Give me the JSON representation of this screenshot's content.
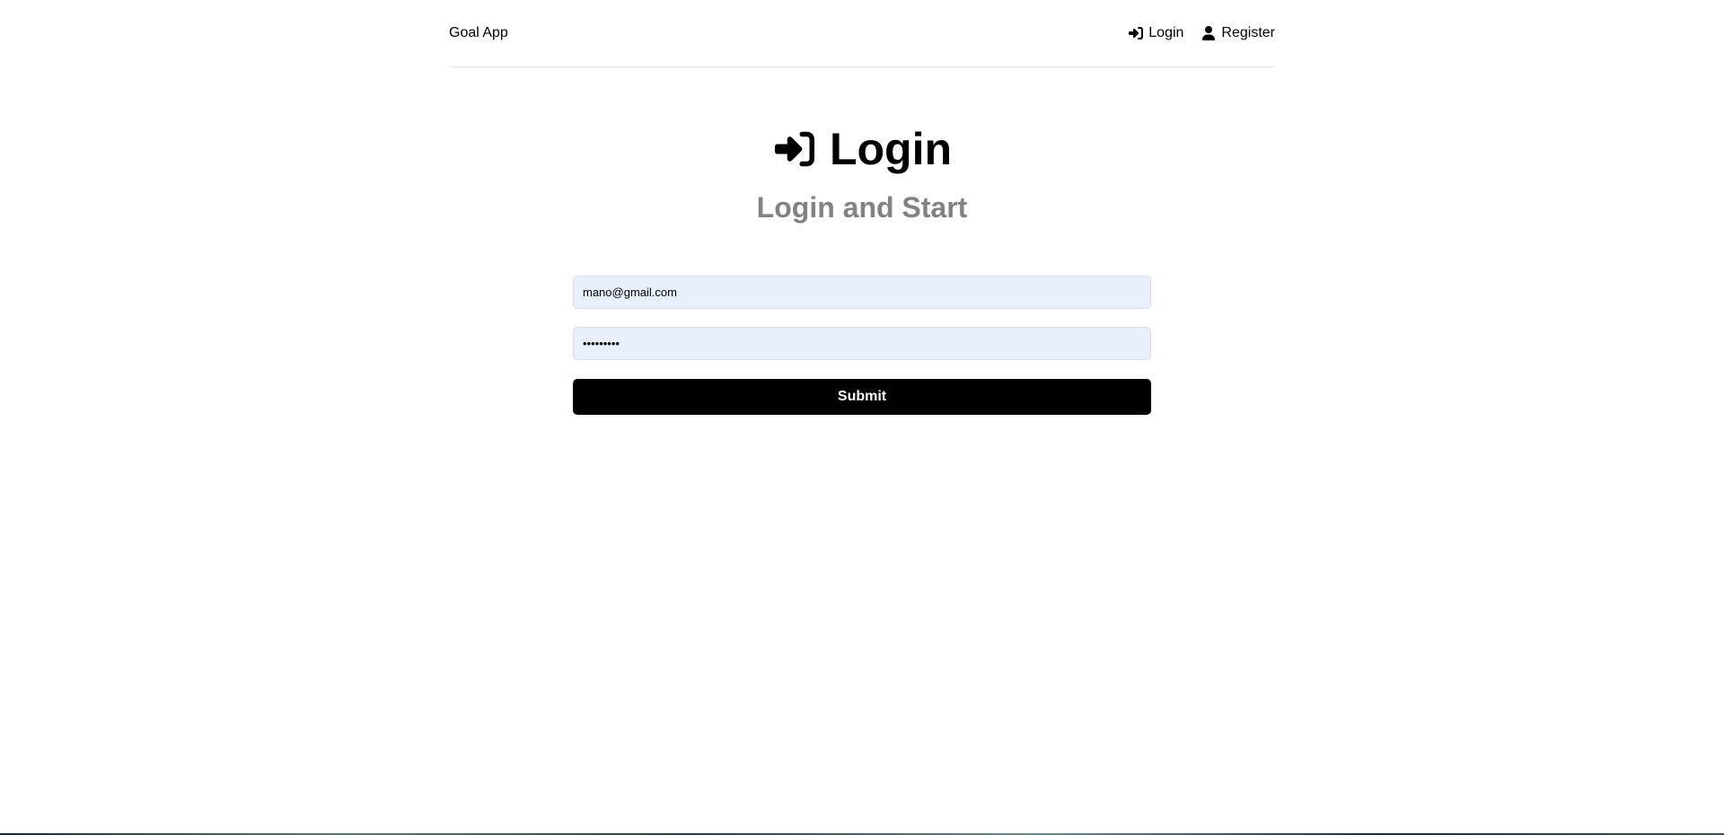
{
  "header": {
    "brand": "Goal App",
    "nav": {
      "login_label": "Login",
      "register_label": "Register"
    }
  },
  "hero": {
    "title": "Login",
    "subtitle": "Login and Start"
  },
  "form": {
    "email": {
      "value": "mano@gmail.com",
      "placeholder": ""
    },
    "password": {
      "value": "•••••••••",
      "placeholder": ""
    },
    "submit_label": "Submit"
  },
  "icons": {
    "login": "sign-in-icon",
    "register": "user-icon"
  },
  "colors": {
    "accent": "#000000",
    "subtitle": "#828282",
    "input_bg": "#e8f0fe"
  }
}
